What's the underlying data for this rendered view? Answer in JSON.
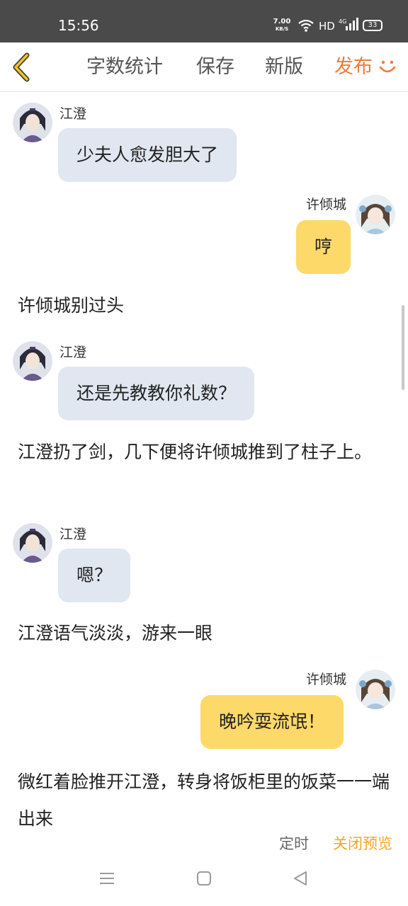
{
  "status_bar": {
    "time": "15:56",
    "net_speed_value": "7.00",
    "net_speed_unit": "KB/S",
    "hd": "HD",
    "network": "4G",
    "battery": "33"
  },
  "toolbar": {
    "back_icon": "chevron-left-icon",
    "word_count": "字数统计",
    "save": "保存",
    "new_version": "新版",
    "publish": "发布",
    "smile_icon": "smile-icon",
    "accent_color": "#f07a3a"
  },
  "chat": {
    "msg1": {
      "speaker": "江澄",
      "text": "少夫人愈发胆大了"
    },
    "msg2": {
      "speaker": "许倾城",
      "text": "哼"
    },
    "narr1": "许倾城别过头",
    "msg3": {
      "speaker": "江澄",
      "text": "还是先教教你礼数？"
    },
    "narr2": "江澄扔了剑，几下便将许倾城推到了柱子上。",
    "msg4": {
      "speaker": "江澄",
      "text": "嗯？"
    },
    "narr3": "江澄语气淡淡，游来一眼",
    "msg5": {
      "speaker": "许倾城",
      "text": "晚吟耍流氓！"
    },
    "narr4": "微红着脸推开江澄，转身将饭柜里的饭菜一一端出来"
  },
  "footer": {
    "timer": "定时",
    "close_preview": "关闭预览",
    "highlight_color": "#f5a623"
  },
  "colors": {
    "left_bubble": "#e1e7f0",
    "right_bubble": "#fdd96a",
    "status_bar": "#4a4a4a"
  },
  "nav": {
    "menu_icon": "menu-icon",
    "home_icon": "home-square-icon",
    "back_icon": "back-triangle-icon"
  }
}
